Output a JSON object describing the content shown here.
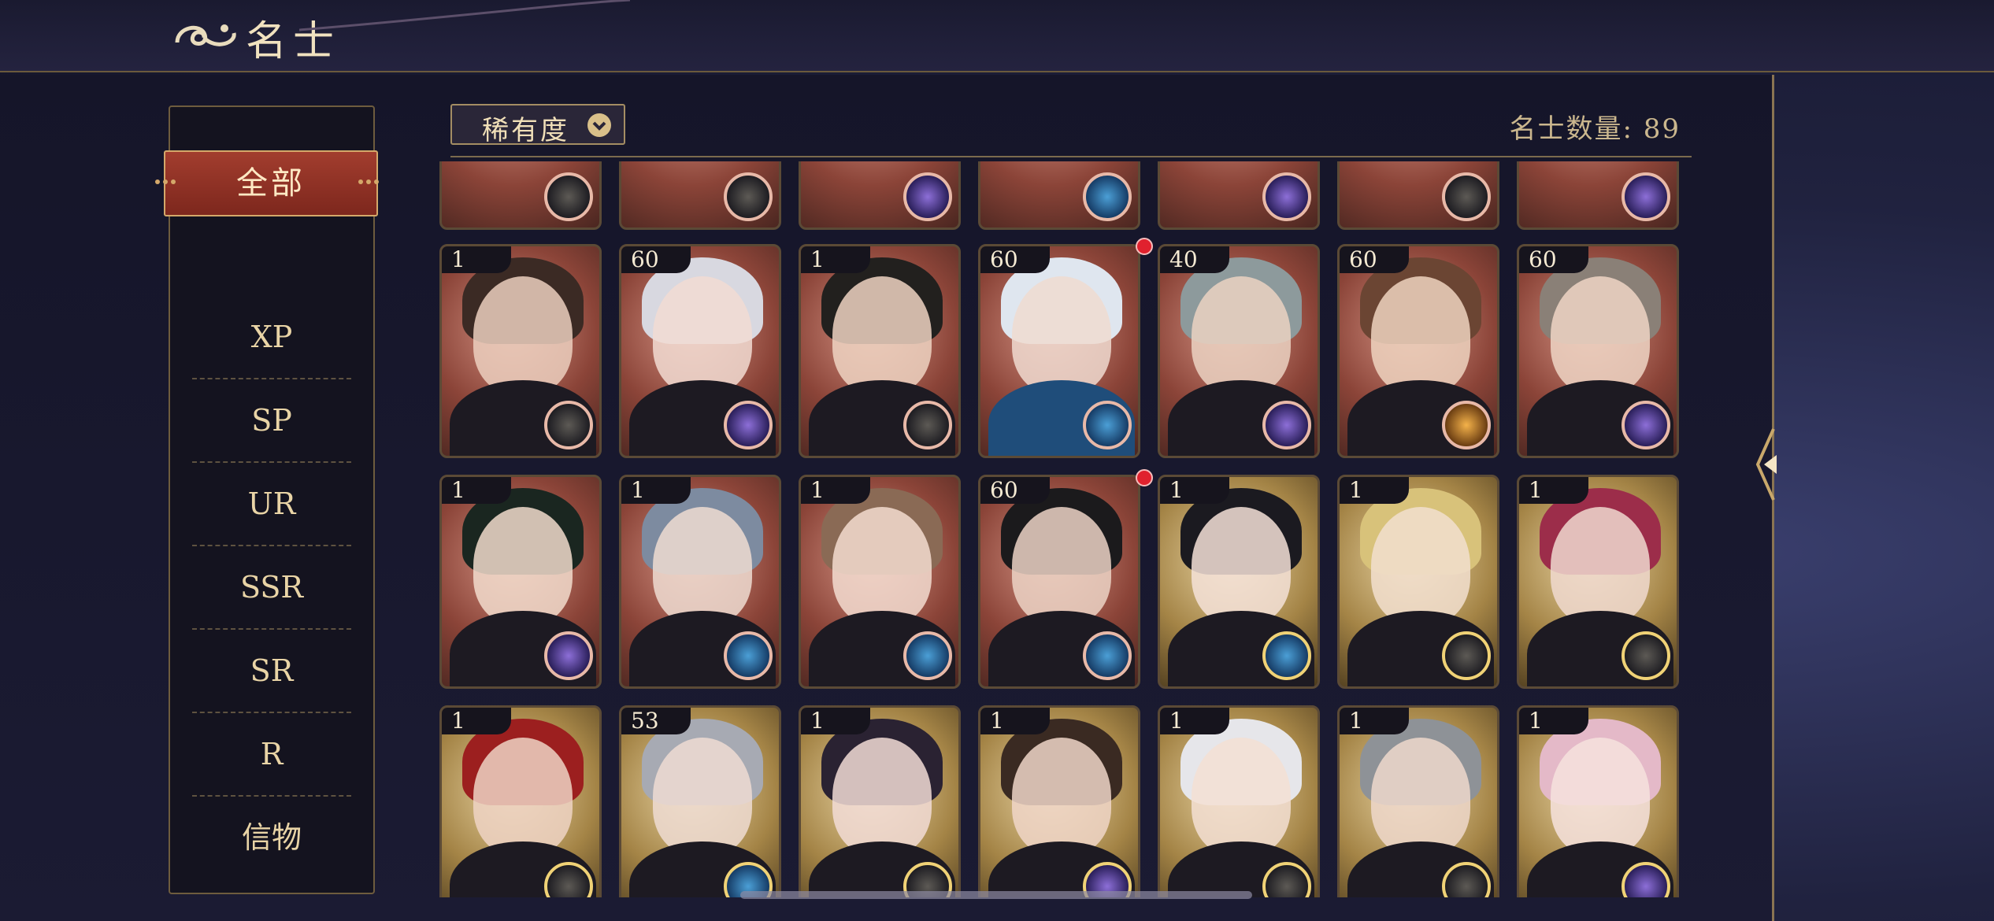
{
  "header": {
    "title": "名士"
  },
  "sidebar": {
    "items": [
      {
        "label": "全部",
        "selected": true
      },
      {
        "label": "XP"
      },
      {
        "label": "SP"
      },
      {
        "label": "UR"
      },
      {
        "label": "SSR"
      },
      {
        "label": "SR"
      },
      {
        "label": "R"
      },
      {
        "label": "信物"
      }
    ]
  },
  "filter": {
    "rarity_label": "稀有度",
    "count_label": "名士数量: 89"
  },
  "colors": {
    "accent_red": "#a23d2e",
    "gold": "#d4a86a",
    "notify": "#e0212e"
  },
  "cards": {
    "partial_row": [
      {
        "emblem": "compass-icon"
      },
      {
        "emblem": "compass-icon"
      },
      {
        "emblem": "planet-icon"
      },
      {
        "emblem": "ocean-icon"
      },
      {
        "emblem": "planet-icon"
      },
      {
        "emblem": "compass-icon"
      },
      {
        "emblem": "planet-icon"
      }
    ],
    "row1": [
      {
        "level": "1",
        "emblem": "compass-icon"
      },
      {
        "level": "60",
        "emblem": "planet-icon"
      },
      {
        "level": "1",
        "emblem": "compass-icon"
      },
      {
        "level": "60",
        "emblem": "ocean-icon",
        "notify": true
      },
      {
        "level": "40",
        "emblem": "planet-icon"
      },
      {
        "level": "60",
        "emblem": "sun-icon"
      },
      {
        "level": "60",
        "emblem": "planet-icon"
      }
    ],
    "row2": [
      {
        "level": "1",
        "emblem": "planet-icon"
      },
      {
        "level": "1",
        "emblem": "ocean-icon"
      },
      {
        "level": "1",
        "emblem": "ocean-icon"
      },
      {
        "level": "60",
        "emblem": "ocean-icon",
        "notify": true
      },
      {
        "level": "1",
        "emblem": "ocean-icon"
      },
      {
        "level": "1",
        "emblem": "compass-icon"
      },
      {
        "level": "1",
        "emblem": "compass-icon"
      }
    ],
    "row3": [
      {
        "level": "1",
        "emblem": "compass-icon"
      },
      {
        "level": "53",
        "emblem": "ocean-icon"
      },
      {
        "level": "1",
        "emblem": "compass-icon"
      },
      {
        "level": "1",
        "emblem": "planet-icon"
      },
      {
        "level": "1",
        "emblem": "compass-icon"
      },
      {
        "level": "1",
        "emblem": "compass-icon"
      },
      {
        "level": "1",
        "emblem": "planet-icon"
      }
    ]
  }
}
